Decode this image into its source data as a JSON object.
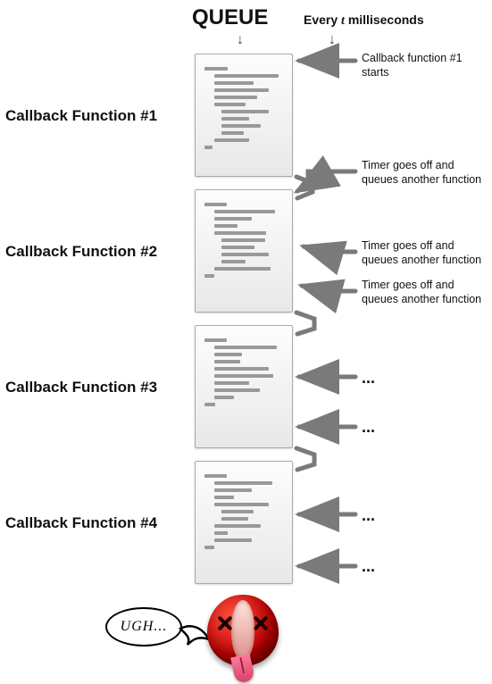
{
  "header": {
    "queue": "QUEUE",
    "every_prefix": "Every ",
    "every_var": "t",
    "every_suffix": " milliseconds"
  },
  "callbacks": [
    {
      "label": "Callback Function #1"
    },
    {
      "label": "Callback Function #2"
    },
    {
      "label": "Callback Function #3"
    },
    {
      "label": "Callback Function #4"
    }
  ],
  "annotations": {
    "cb1_start_l1": "Callback function #1",
    "cb1_start_l2": "starts",
    "timer_l1": "Timer goes off and",
    "timer_l2": "queues another function",
    "dots": "..."
  },
  "bubble": {
    "text": "UGH..."
  }
}
